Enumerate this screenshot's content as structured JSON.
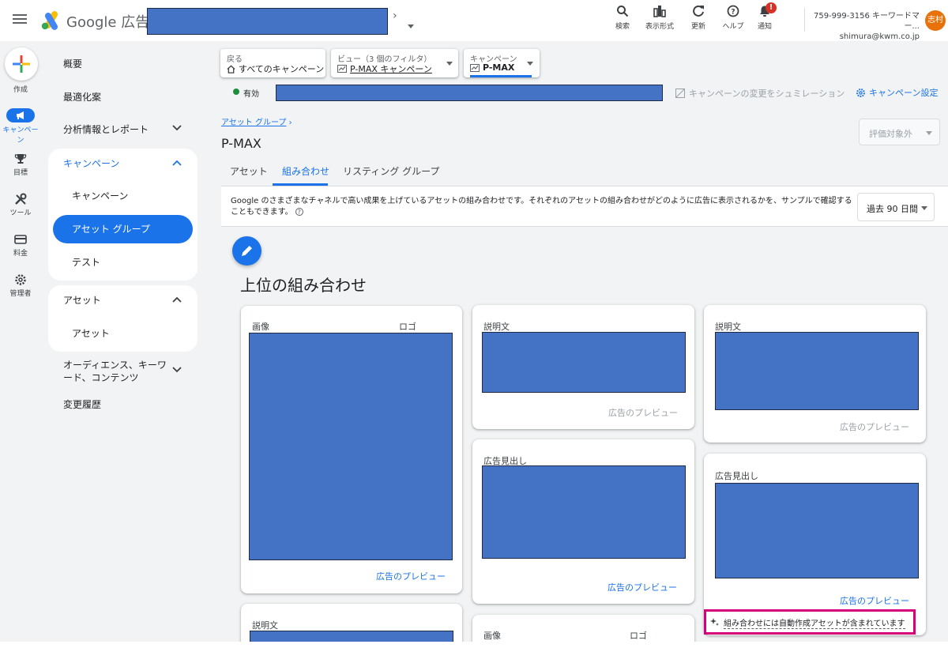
{
  "header": {
    "product_name": "Google 広告",
    "actions": [
      {
        "name": "search",
        "label": "検索"
      },
      {
        "name": "display",
        "label": "表示形式"
      },
      {
        "name": "refresh",
        "label": "更新"
      },
      {
        "name": "help",
        "label": "ヘルプ"
      },
      {
        "name": "notifications",
        "label": "通知",
        "badge": "!"
      }
    ],
    "account_line": "759-999-3156 キーワードマー...",
    "email": "shimura@kwm.co.jp",
    "avatar_text": "志村"
  },
  "rail": {
    "items": [
      {
        "label": "作成"
      },
      {
        "label": "キャンペーン"
      },
      {
        "label": "目標"
      },
      {
        "label": "ツール"
      },
      {
        "label": "料金"
      },
      {
        "label": "管理者"
      }
    ]
  },
  "sidenav": {
    "overview": "概要",
    "recommendations": "最適化案",
    "insights_reports": "分析情報とレポート",
    "campaigns_group": "キャンペーン",
    "campaigns_item": "キャンペーン",
    "asset_groups_item": "アセット グループ",
    "experiments_item": "テスト",
    "assets_group": "アセット",
    "assets_item": "アセット",
    "audiences": "オーディエンス、キーワード、コンテンツ",
    "change_history": "変更履歴"
  },
  "toolbar": {
    "back_label": "戻る",
    "back_value": "すべてのキャンペーン",
    "view_label": "ビュー（3 個のフィルタ）",
    "view_value": "P-MAX キャンペーン",
    "campaign_label": "キャンペーン",
    "campaign_value": "P-MAX"
  },
  "status": {
    "label": "有効",
    "simulate": "キャンペーンの変更をシュミレーション",
    "settings": "キャンペーン設定"
  },
  "page": {
    "breadcrumb": "アセット グループ",
    "title": "P-MAX",
    "eval_dropdown": "評価対象外",
    "tabs": [
      "アセット",
      "組み合わせ",
      "リスティング グループ"
    ],
    "active_tab": 1,
    "description": "Google のさまざまなチャネルで高い成果を上げているアセットの組み合わせです。それぞれのアセットの組み合わせがどのように広告に表示されるかを、サンプルで確認することもできます。",
    "date_range": "過去 90 日間",
    "section_title": "上位の組み合わせ",
    "auto_assets_notice": "組み合わせには自動作成アセットが含まれています"
  },
  "cards": {
    "image": "画像",
    "logo": "ロゴ",
    "description": "説明文",
    "headline": "広告見出し",
    "preview": "広告のプレビュー"
  },
  "colors": {
    "accent": "#1a73e8",
    "status_green": "#1e8e3e",
    "avatar": "#e8710a",
    "highlight_border": "#d6007a",
    "redaction": "#4472c4"
  }
}
